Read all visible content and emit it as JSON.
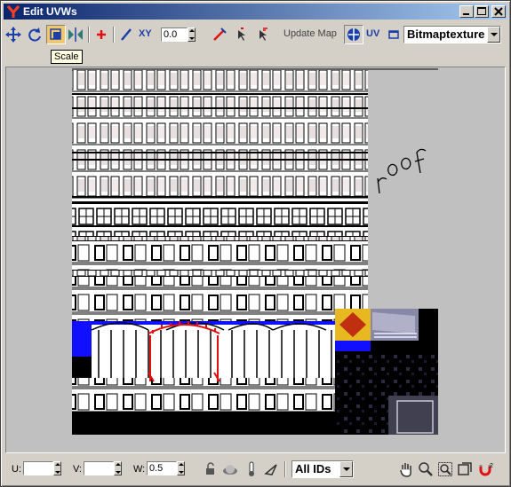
{
  "window": {
    "title": "Edit UVWs",
    "controls": [
      "minimize",
      "maximize",
      "close"
    ]
  },
  "toolbar": {
    "tools": [
      {
        "name": "move-icon"
      },
      {
        "name": "rotate-icon"
      },
      {
        "name": "scale-icon",
        "active": true
      },
      {
        "name": "mirror-icon"
      },
      {
        "name": "freeform-icon"
      },
      {
        "name": "pick-icon"
      },
      {
        "name": "break-icon"
      },
      {
        "name": "weld-icon"
      }
    ],
    "axis_label": "XY",
    "axis_value": "0.0",
    "update_map_label": "Update Map",
    "uv_label": "UV",
    "map_dropdown": "Bitmaptexture"
  },
  "tooltip": {
    "text": "Scale"
  },
  "canvas": {
    "annotation_text": "roof",
    "texture_name": "building facade texture",
    "colors": {
      "background": "#c0c0c0",
      "facade_white": "#ffffff",
      "shadow_black": "#000000",
      "highlight_blue": "#1010ff",
      "selection_red": "#e01010"
    }
  },
  "statusbar": {
    "u_label": "U:",
    "u_value": "",
    "v_label": "V:",
    "v_value": "",
    "w_label": "W:",
    "w_value": "0.5",
    "ids_dropdown": "All IDs",
    "tools": [
      "lock-icon",
      "sphere-icon",
      "thermometer-icon",
      "pick-icon",
      "pan-icon",
      "zoom-icon",
      "zoom-region-icon",
      "zoom-extents-icon",
      "magnet-icon"
    ]
  }
}
